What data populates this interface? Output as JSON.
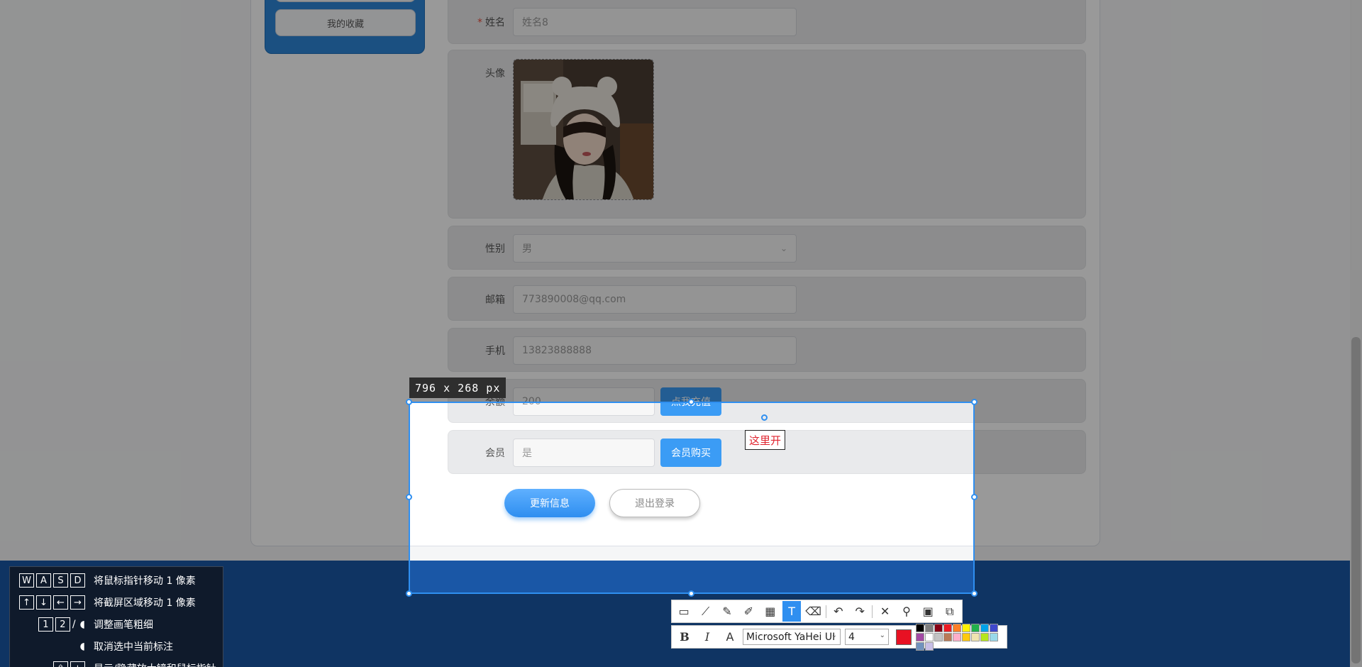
{
  "sidebar": {
    "favorites_label": "我的收藏"
  },
  "form": {
    "name": {
      "label": "姓名",
      "placeholder": "姓名8"
    },
    "avatar": {
      "label": "头像"
    },
    "gender": {
      "label": "性别",
      "value": "男"
    },
    "email": {
      "label": "邮箱",
      "value": "773890008@qq.com"
    },
    "phone": {
      "label": "手机",
      "value": "13823888888"
    },
    "balance": {
      "label": "余额",
      "value": "200",
      "button": "点我充值"
    },
    "member": {
      "label": "会员",
      "value": "是",
      "button": "会员购买"
    },
    "update_button": "更新信息",
    "logout_button": "退出登录"
  },
  "capture": {
    "size_label": "796 x 268 px",
    "text_annotation": "这里开"
  },
  "toolbar": {
    "icons": [
      "rect-tool-icon",
      "polyline-tool-icon",
      "pen-tool-icon",
      "marker-tool-icon",
      "mosaic-tool-icon",
      "text-tool-icon",
      "eraser-tool-icon",
      "undo-icon",
      "redo-icon",
      "close-icon",
      "pin-icon",
      "save-icon",
      "copy-icon"
    ],
    "active_tool": "text-tool-icon"
  },
  "text_toolbar": {
    "bold": "B",
    "italic": "I",
    "outline": "A",
    "font_name": "Microsoft YaHei UI",
    "font_size": "4",
    "current_color": "#e81123",
    "palette": [
      "#000000",
      "#7f7f7f",
      "#880015",
      "#ed1c24",
      "#ff7f27",
      "#fff200",
      "#22b14c",
      "#00a2e8",
      "#3f48cc",
      "#a349a4",
      "#ffffff",
      "#c3c3c3",
      "#b97a57",
      "#ffaec9",
      "#ffc90e",
      "#efe4b0",
      "#b5e61d",
      "#99d9ea",
      "#7092be",
      "#c8bfe7"
    ]
  },
  "shortcuts": [
    {
      "keys": [
        "W",
        "A",
        "S",
        "D"
      ],
      "text": "将鼠标指针移动 1 像素"
    },
    {
      "keys": [
        "↑",
        "↓",
        "←",
        "→"
      ],
      "text": "将截屏区域移动 1 像素"
    },
    {
      "keys": [
        "1",
        "2"
      ],
      "suffix": "/",
      "text": "调整画笔粗细"
    },
    {
      "keys": [],
      "text": "取消选中当前标注"
    },
    {
      "keys": [
        "⇧",
        "+"
      ],
      "text": "显示/隐藏放大镜和鼠标指针"
    }
  ]
}
